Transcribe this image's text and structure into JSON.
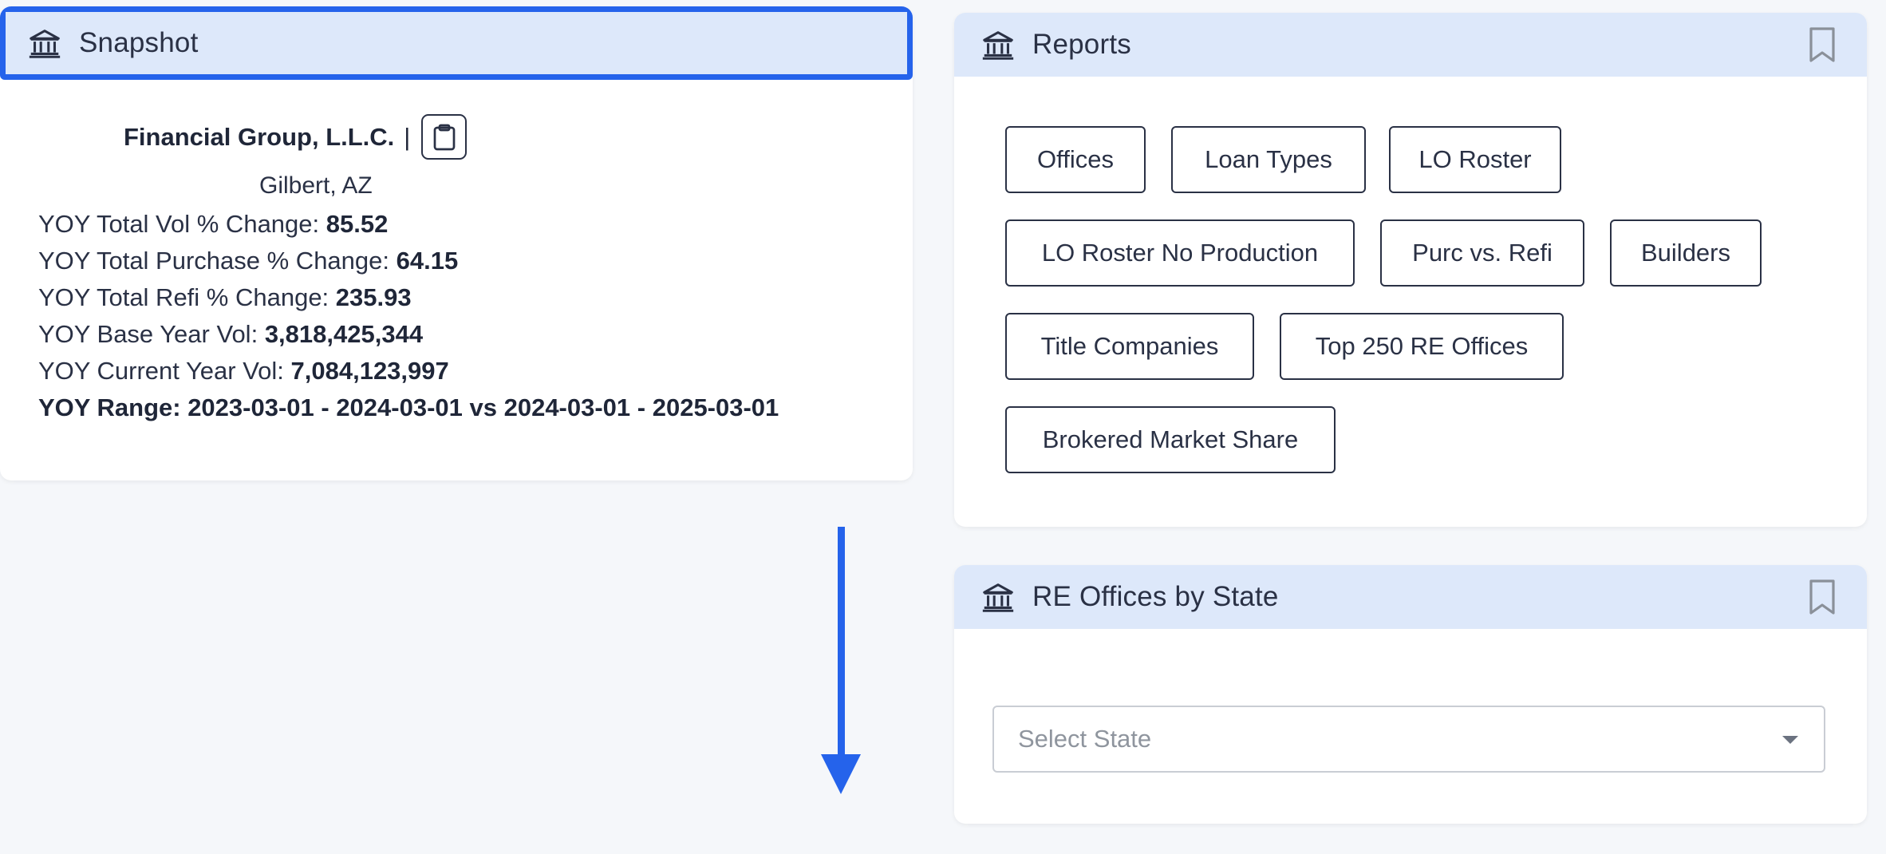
{
  "snapshot": {
    "title": "Snapshot",
    "icon": "bank-icon",
    "company_name": "Financial Group, L.L.C.",
    "separator": "|",
    "clipboard_icon": "clipboard-icon",
    "location": "Gilbert, AZ",
    "stats": [
      {
        "label": "YOY Total Vol % Change: ",
        "value": "85.52"
      },
      {
        "label": "YOY Total Purchase % Change: ",
        "value": "64.15"
      },
      {
        "label": "YOY Total Refi % Change: ",
        "value": "235.93"
      },
      {
        "label": "YOY Base Year Vol: ",
        "value": "3,818,425,344"
      },
      {
        "label": "YOY Current Year Vol: ",
        "value": "7,084,123,997"
      }
    ],
    "range": "YOY Range: 2023-03-01 - 2024-03-01 vs 2024-03-01 - 2025-03-01"
  },
  "reports": {
    "title": "Reports",
    "icon": "bank-icon",
    "bookmark_icon": "bookmark-icon",
    "buttons": [
      "Offices",
      "Loan Types",
      "LO Roster",
      "LO Roster No Production",
      "Purc vs. Refi",
      "Builders",
      "Title Companies",
      "Top 250 RE Offices",
      "Brokered Market Share"
    ]
  },
  "re_offices": {
    "title": "RE Offices by State",
    "icon": "bank-icon",
    "bookmark_icon": "bookmark-icon",
    "select_placeholder": "Select State",
    "caret_icon": "caret-down-icon"
  },
  "colors": {
    "header_bg": "#dde8fa",
    "highlight_border": "#2563eb",
    "arrow": "#2563eb",
    "text": "#2a3145"
  }
}
